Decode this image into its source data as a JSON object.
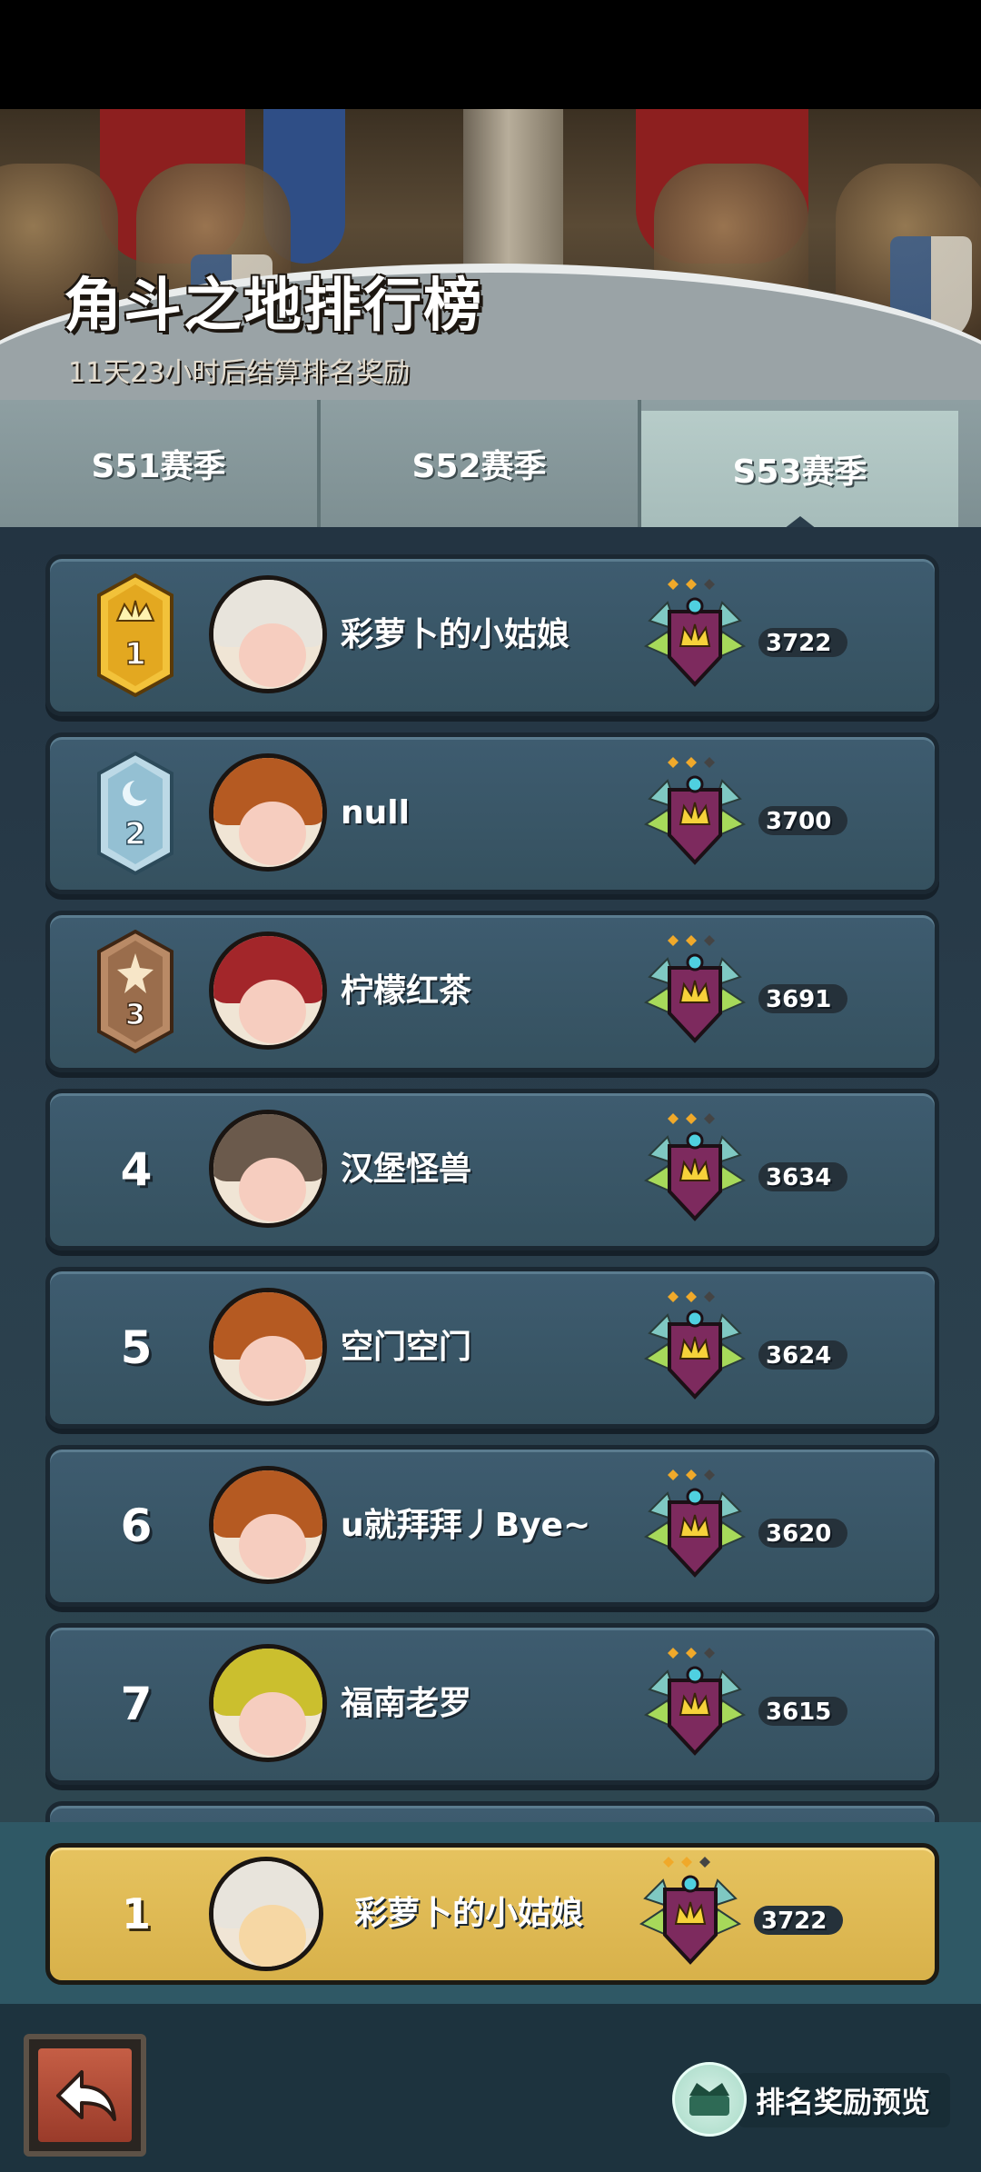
{
  "header": {
    "title": "角斗之地排行榜",
    "subtitle": "11天23小时后结算排名奖励"
  },
  "tabs": [
    {
      "label": "S51赛季",
      "active": false
    },
    {
      "label": "S52赛季",
      "active": false
    },
    {
      "label": "S53赛季",
      "active": true
    }
  ],
  "leaderboard": [
    {
      "rank": "1",
      "name": "彩萝卜的小姑娘",
      "score": "3722",
      "badge": "gold-crown-badge",
      "hat_color": "#e8e4dc"
    },
    {
      "rank": "2",
      "name": "null",
      "score": "3700",
      "badge": "silver-moon-badge",
      "hat_color": "#b55a22"
    },
    {
      "rank": "3",
      "name": "柠檬红茶",
      "score": "3691",
      "badge": "bronze-star-badge",
      "hat_color": "#a3262a"
    },
    {
      "rank": "4",
      "name": "汉堡怪兽",
      "score": "3634",
      "badge": "",
      "hat_color": "#6b5a4c"
    },
    {
      "rank": "5",
      "name": "空门空门",
      "score": "3624",
      "badge": "",
      "hat_color": "#b55a22"
    },
    {
      "rank": "6",
      "name": "u就拜拜丿Bye~",
      "score": "3620",
      "badge": "",
      "hat_color": "#b55a22"
    },
    {
      "rank": "7",
      "name": "福南老罗",
      "score": "3615",
      "badge": "",
      "hat_color": "#cbbf2e"
    }
  ],
  "my_rank": {
    "rank": "1",
    "name": "彩萝卜的小姑娘",
    "score": "3722"
  },
  "footer": {
    "back_icon": "back-arrow-icon",
    "reward_preview_label": "排名奖励预览"
  },
  "colors": {
    "row_bg": "#3e5c70",
    "my_row_bg": "#e6c35f",
    "active_tab": "#b7ccc9"
  }
}
